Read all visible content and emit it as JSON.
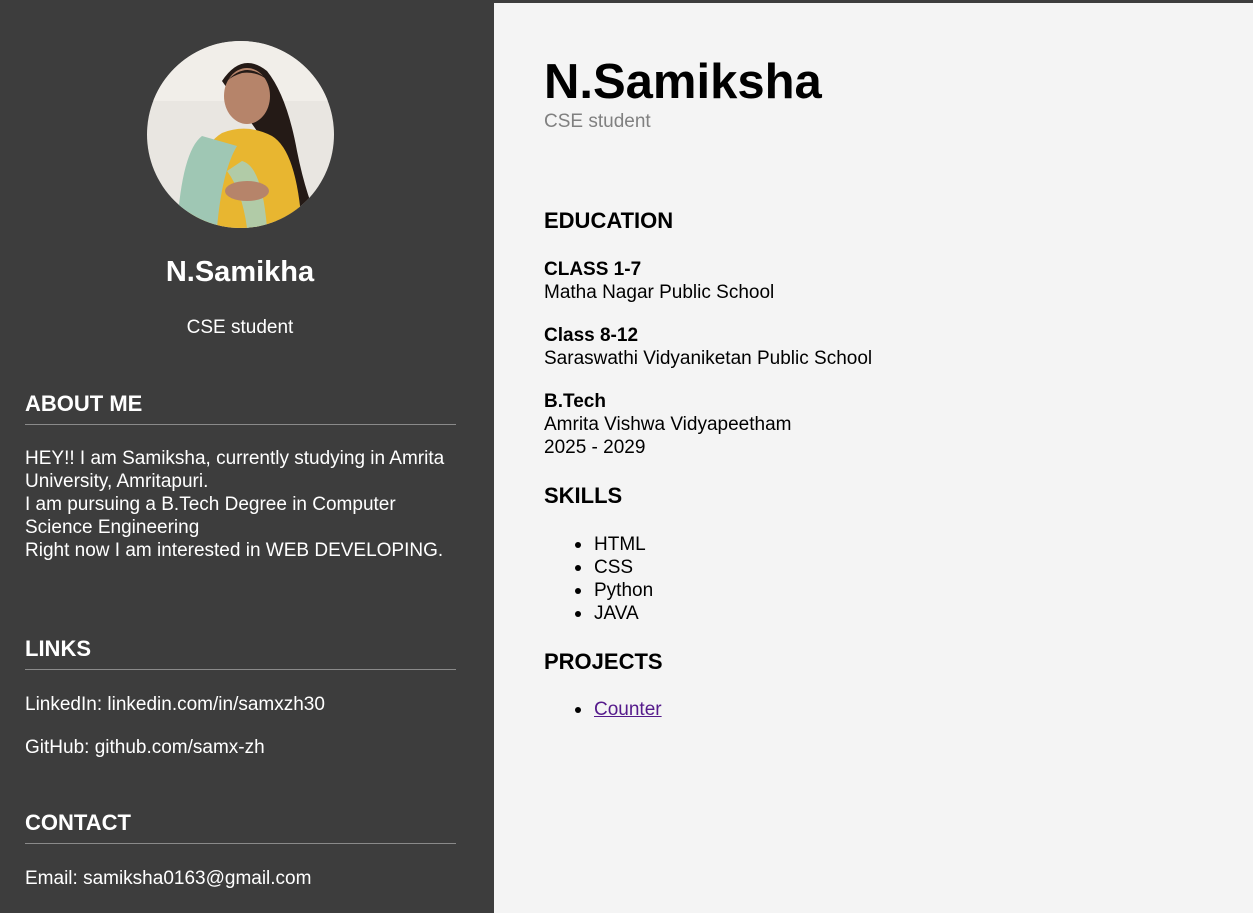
{
  "sidebar": {
    "name": "N.Samikha",
    "role": "CSE student",
    "about": {
      "heading": "ABOUT ME",
      "lines": [
        "HEY!! I am Samiksha, currently studying in Amrita University, Amritapuri.",
        "I am pursuing a B.Tech Degree in Computer Science Engineering",
        "Right now I am interested in WEB DEVELOPING."
      ]
    },
    "links": {
      "heading": "LINKS",
      "linkedin": "LinkedIn: linkedin.com/in/samxzh30",
      "github": "GitHub: github.com/samx-zh"
    },
    "contact": {
      "heading": "CONTACT",
      "email": "Email: samiksha0163@gmail.com"
    }
  },
  "main": {
    "name": "N.Samiksha",
    "role": "CSE student",
    "education": {
      "heading": "EDUCATION",
      "items": [
        {
          "level": "CLASS 1-7",
          "school": "Matha Nagar Public School",
          "years": ""
        },
        {
          "level": "Class 8-12",
          "school": "Saraswathi Vidyaniketan Public School",
          "years": ""
        },
        {
          "level": "B.Tech",
          "school": "Amrita Vishwa Vidyapeetham",
          "years": "2025 - 2029"
        }
      ]
    },
    "skills": {
      "heading": "SKILLS",
      "items": [
        "HTML",
        "CSS",
        "Python",
        "JAVA"
      ]
    },
    "projects": {
      "heading": "PROJECTS",
      "items": [
        "Counter"
      ]
    }
  },
  "colors": {
    "sidebar_bg": "#3d3d3d",
    "main_bg": "#f4f4f4",
    "muted_text": "#808080",
    "visited_link": "#551a8b"
  }
}
